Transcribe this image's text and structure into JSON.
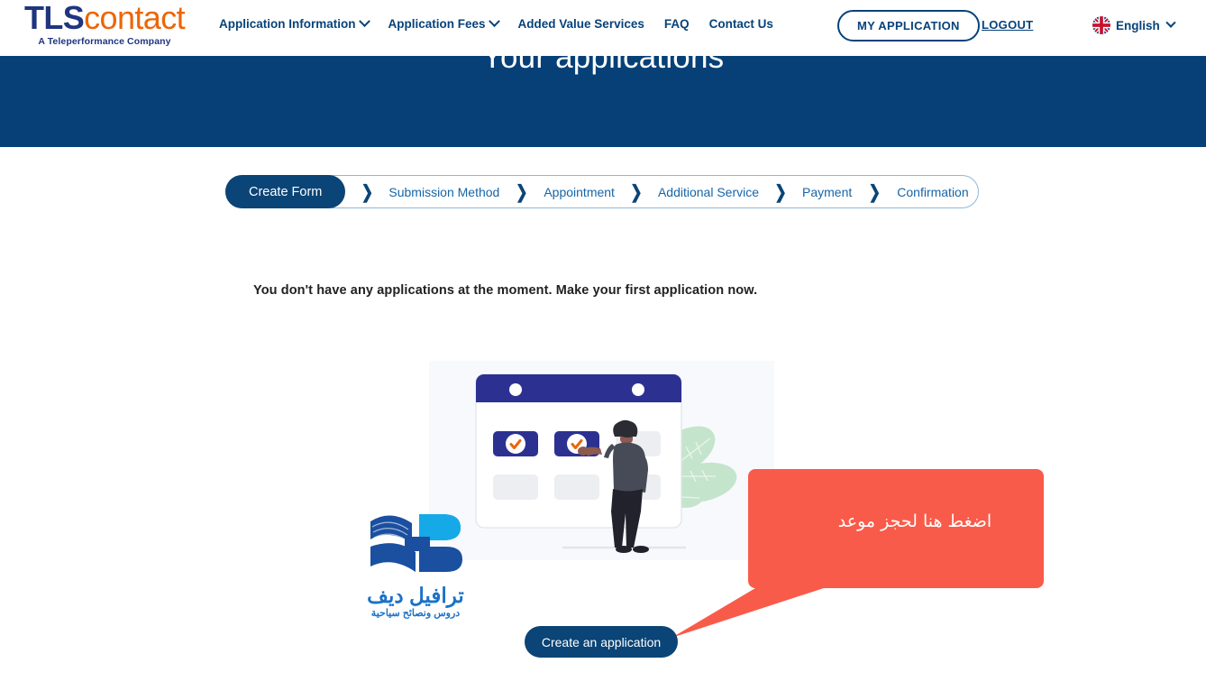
{
  "header": {
    "logo": {
      "part1": "TLS",
      "part2": "contact",
      "tagline": "A Teleperformance Company"
    },
    "nav": [
      {
        "label": "Application Information",
        "has_dropdown": true
      },
      {
        "label": "Application Fees",
        "has_dropdown": true
      },
      {
        "label": "Added Value Services",
        "has_dropdown": false
      },
      {
        "label": "FAQ",
        "has_dropdown": false
      },
      {
        "label": "Contact Us",
        "has_dropdown": false
      }
    ],
    "my_application_label": "MY APPLICATION",
    "logout_label": "LOGOUT",
    "language": {
      "label": "English",
      "flag_icon": "uk-flag-icon"
    }
  },
  "banner": {
    "title": "Your applications",
    "background_color": "#064076"
  },
  "stepper": {
    "steps": [
      {
        "label": "Create Form",
        "active": true
      },
      {
        "label": "Submission Method",
        "active": false
      },
      {
        "label": "Appointment",
        "active": false
      },
      {
        "label": "Additional Service",
        "active": false
      },
      {
        "label": "Payment",
        "active": false
      },
      {
        "label": "Confirmation",
        "active": false
      }
    ],
    "separator": "❯",
    "active_color": "#0b4476",
    "inactive_color": "#1565a8"
  },
  "main": {
    "empty_message": "You don't have any applications at the moment. Make your first application now.",
    "illustration_alt": "person-selecting-calendar-dates-illustration",
    "cta_label": "Create an application"
  },
  "watermark": {
    "title": "ترافيل ديف",
    "subtitle": "دروس ونصائح سياحية",
    "color": "#1b72c6"
  },
  "callout": {
    "text": "اضغط هنا لحجز موعد",
    "color": "#f95b4a"
  }
}
